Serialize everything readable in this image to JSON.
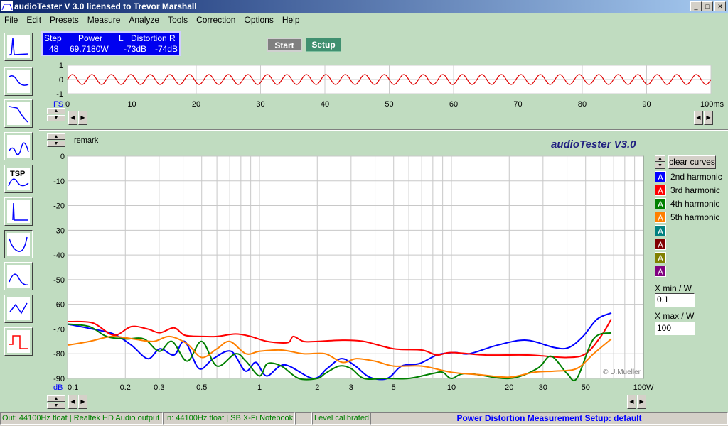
{
  "window": {
    "title": "audioTester  V 3.0   licensed to Trevor Marshall",
    "min": "_",
    "max": "□",
    "close": "✕"
  },
  "menu": [
    "File",
    "Edit",
    "Presets",
    "Measure",
    "Analyze",
    "Tools",
    "Correction",
    "Options",
    "Help"
  ],
  "lcd": {
    "step_label": "Step",
    "power_label": "Power",
    "l_label": "L",
    "distortion_label": "Distortion",
    "r_label": "R",
    "step": "48",
    "power": "69.7180W",
    "l_value": "-73dB",
    "r_value": "-74dB"
  },
  "buttons": {
    "start": "Start",
    "setup": "Setup",
    "clear_curves": "clear curves"
  },
  "scope": {
    "fs_label": "FS",
    "y_ticks": [
      "1",
      "0",
      "-1"
    ],
    "x_ticks": [
      "0",
      "10",
      "20",
      "30",
      "40",
      "50",
      "60",
      "70",
      "80",
      "90",
      "100ms"
    ],
    "cycles": 33,
    "amplitude": 0.35
  },
  "remark": "remark",
  "brand": "audioTester  V3.0",
  "copyright": "© U.Mueller",
  "legend": [
    {
      "label": "2nd harmonic",
      "color": "#0000ff",
      "glyph": "A"
    },
    {
      "label": "3rd harmonic",
      "color": "#ff0000",
      "glyph": "A"
    },
    {
      "label": "4th harmonic",
      "color": "#008000",
      "glyph": "A"
    },
    {
      "label": "5th harmonic",
      "color": "#ff8000",
      "glyph": "A"
    },
    {
      "label": "",
      "color": "#008080",
      "glyph": "A"
    },
    {
      "label": "",
      "color": "#800000",
      "glyph": "A"
    },
    {
      "label": "",
      "color": "#808000",
      "glyph": "A"
    },
    {
      "label": "",
      "color": "#800080",
      "glyph": "A"
    }
  ],
  "xrange": {
    "min_label": "X min / W",
    "min_value": "0.1",
    "max_label": "X max / W",
    "max_value": "100"
  },
  "chart_data": {
    "type": "line",
    "xscale": "log",
    "xlim": [
      0.1,
      100
    ],
    "ylim": [
      -90,
      0
    ],
    "ylabel": "dB",
    "xlabel": "W",
    "y_ticks": [
      "0",
      "-10",
      "-20",
      "-30",
      "-40",
      "-50",
      "-60",
      "-70",
      "-80",
      "-90"
    ],
    "x_ticks": [
      {
        "v": 0.1,
        "t": "0.1"
      },
      {
        "v": 0.2,
        "t": "0.2"
      },
      {
        "v": 0.3,
        "t": "0.3"
      },
      {
        "v": 0.5,
        "t": "0.5"
      },
      {
        "v": 1,
        "t": "1"
      },
      {
        "v": 2,
        "t": "2"
      },
      {
        "v": 3,
        "t": "3"
      },
      {
        "v": 5,
        "t": "5"
      },
      {
        "v": 10,
        "t": "10"
      },
      {
        "v": 20,
        "t": "20"
      },
      {
        "v": 30,
        "t": "30"
      },
      {
        "v": 50,
        "t": "50"
      },
      {
        "v": 100,
        "t": "100W"
      }
    ],
    "series": [
      {
        "name": "2nd harmonic",
        "color": "#0000ff",
        "x": [
          0.1,
          0.135,
          0.174,
          0.215,
          0.262,
          0.303,
          0.359,
          0.408,
          0.484,
          0.574,
          0.711,
          0.843,
          0.958,
          1.09,
          1.35,
          1.9,
          2.25,
          2.67,
          3.16,
          3.75,
          4.64,
          5.5,
          6.8,
          8.43,
          10.4,
          12.4,
          17.4,
          24.5,
          34.4,
          40.8,
          48.4,
          57.4,
          68.1
        ],
        "y": [
          -68,
          -70,
          -72,
          -76.5,
          -82,
          -78,
          -80.5,
          -75,
          -86,
          -82,
          -79,
          -87,
          -83.5,
          -89,
          -84.5,
          -90,
          -86,
          -82,
          -85,
          -89.5,
          -90,
          -85,
          -84,
          -80.5,
          -79.5,
          -80,
          -76.5,
          -74.5,
          -77.5,
          -77.5,
          -73,
          -66,
          -63.5
        ]
      },
      {
        "name": "3rd harmonic",
        "color": "#ff0000",
        "x": [
          0.1,
          0.135,
          0.174,
          0.215,
          0.262,
          0.303,
          0.359,
          0.408,
          0.5,
          0.6,
          0.75,
          0.9,
          1.1,
          1.4,
          1.5,
          1.7,
          2,
          2.7,
          3.5,
          5,
          7,
          8.4,
          10,
          15,
          25,
          40,
          50,
          60,
          68
        ],
        "y": [
          -67,
          -67.5,
          -72.5,
          -69,
          -70,
          -71.5,
          -69.5,
          -72.5,
          -73,
          -73,
          -72,
          -73,
          -75,
          -75.5,
          -73,
          -75,
          -75,
          -74.5,
          -75,
          -78,
          -78.5,
          -80.5,
          -79.5,
          -80.5,
          -80.5,
          -81.5,
          -80,
          -73,
          -66
        ]
      },
      {
        "name": "4th harmonic",
        "color": "#008000",
        "x": [
          0.1,
          0.13,
          0.16,
          0.2,
          0.25,
          0.3,
          0.35,
          0.42,
          0.5,
          0.6,
          0.75,
          0.85,
          1,
          1.1,
          1.3,
          1.6,
          2,
          2.2,
          2.6,
          3,
          3.5,
          4.5,
          6,
          8,
          9,
          10,
          12,
          20,
          28,
          33,
          40,
          45,
          55,
          68
        ],
        "y": [
          -68,
          -69,
          -73,
          -74,
          -74,
          -79,
          -75,
          -83,
          -75,
          -85,
          -80,
          -83,
          -89,
          -84,
          -85,
          -90,
          -90,
          -88,
          -85,
          -86,
          -90,
          -90,
          -90,
          -88,
          -87.5,
          -90,
          -88,
          -90,
          -86,
          -81,
          -88,
          -90,
          -74,
          -71.5
        ]
      },
      {
        "name": "5th harmonic",
        "color": "#ff8000",
        "x": [
          0.1,
          0.13,
          0.17,
          0.22,
          0.28,
          0.34,
          0.42,
          0.5,
          0.6,
          0.7,
          0.85,
          1,
          1.3,
          1.7,
          2.2,
          2.7,
          3.2,
          4,
          5,
          7,
          10,
          14,
          20,
          27,
          35,
          45,
          55,
          68
        ],
        "y": [
          -76.5,
          -75,
          -73,
          -74,
          -75,
          -73,
          -76,
          -81.5,
          -78,
          -75,
          -80,
          -79,
          -78.5,
          -80,
          -80,
          -83.5,
          -82,
          -83,
          -85,
          -85,
          -87.5,
          -88.5,
          -89.5,
          -87.5,
          -87,
          -86,
          -80,
          -74
        ]
      }
    ]
  },
  "status": [
    "Out: 44100Hz float  | Realtek HD Audio output",
    "In: 44100Hz float  | SB X-Fi Notebook",
    "",
    "Level calibrated",
    "Power Distortion Measurement Setup:  default"
  ]
}
